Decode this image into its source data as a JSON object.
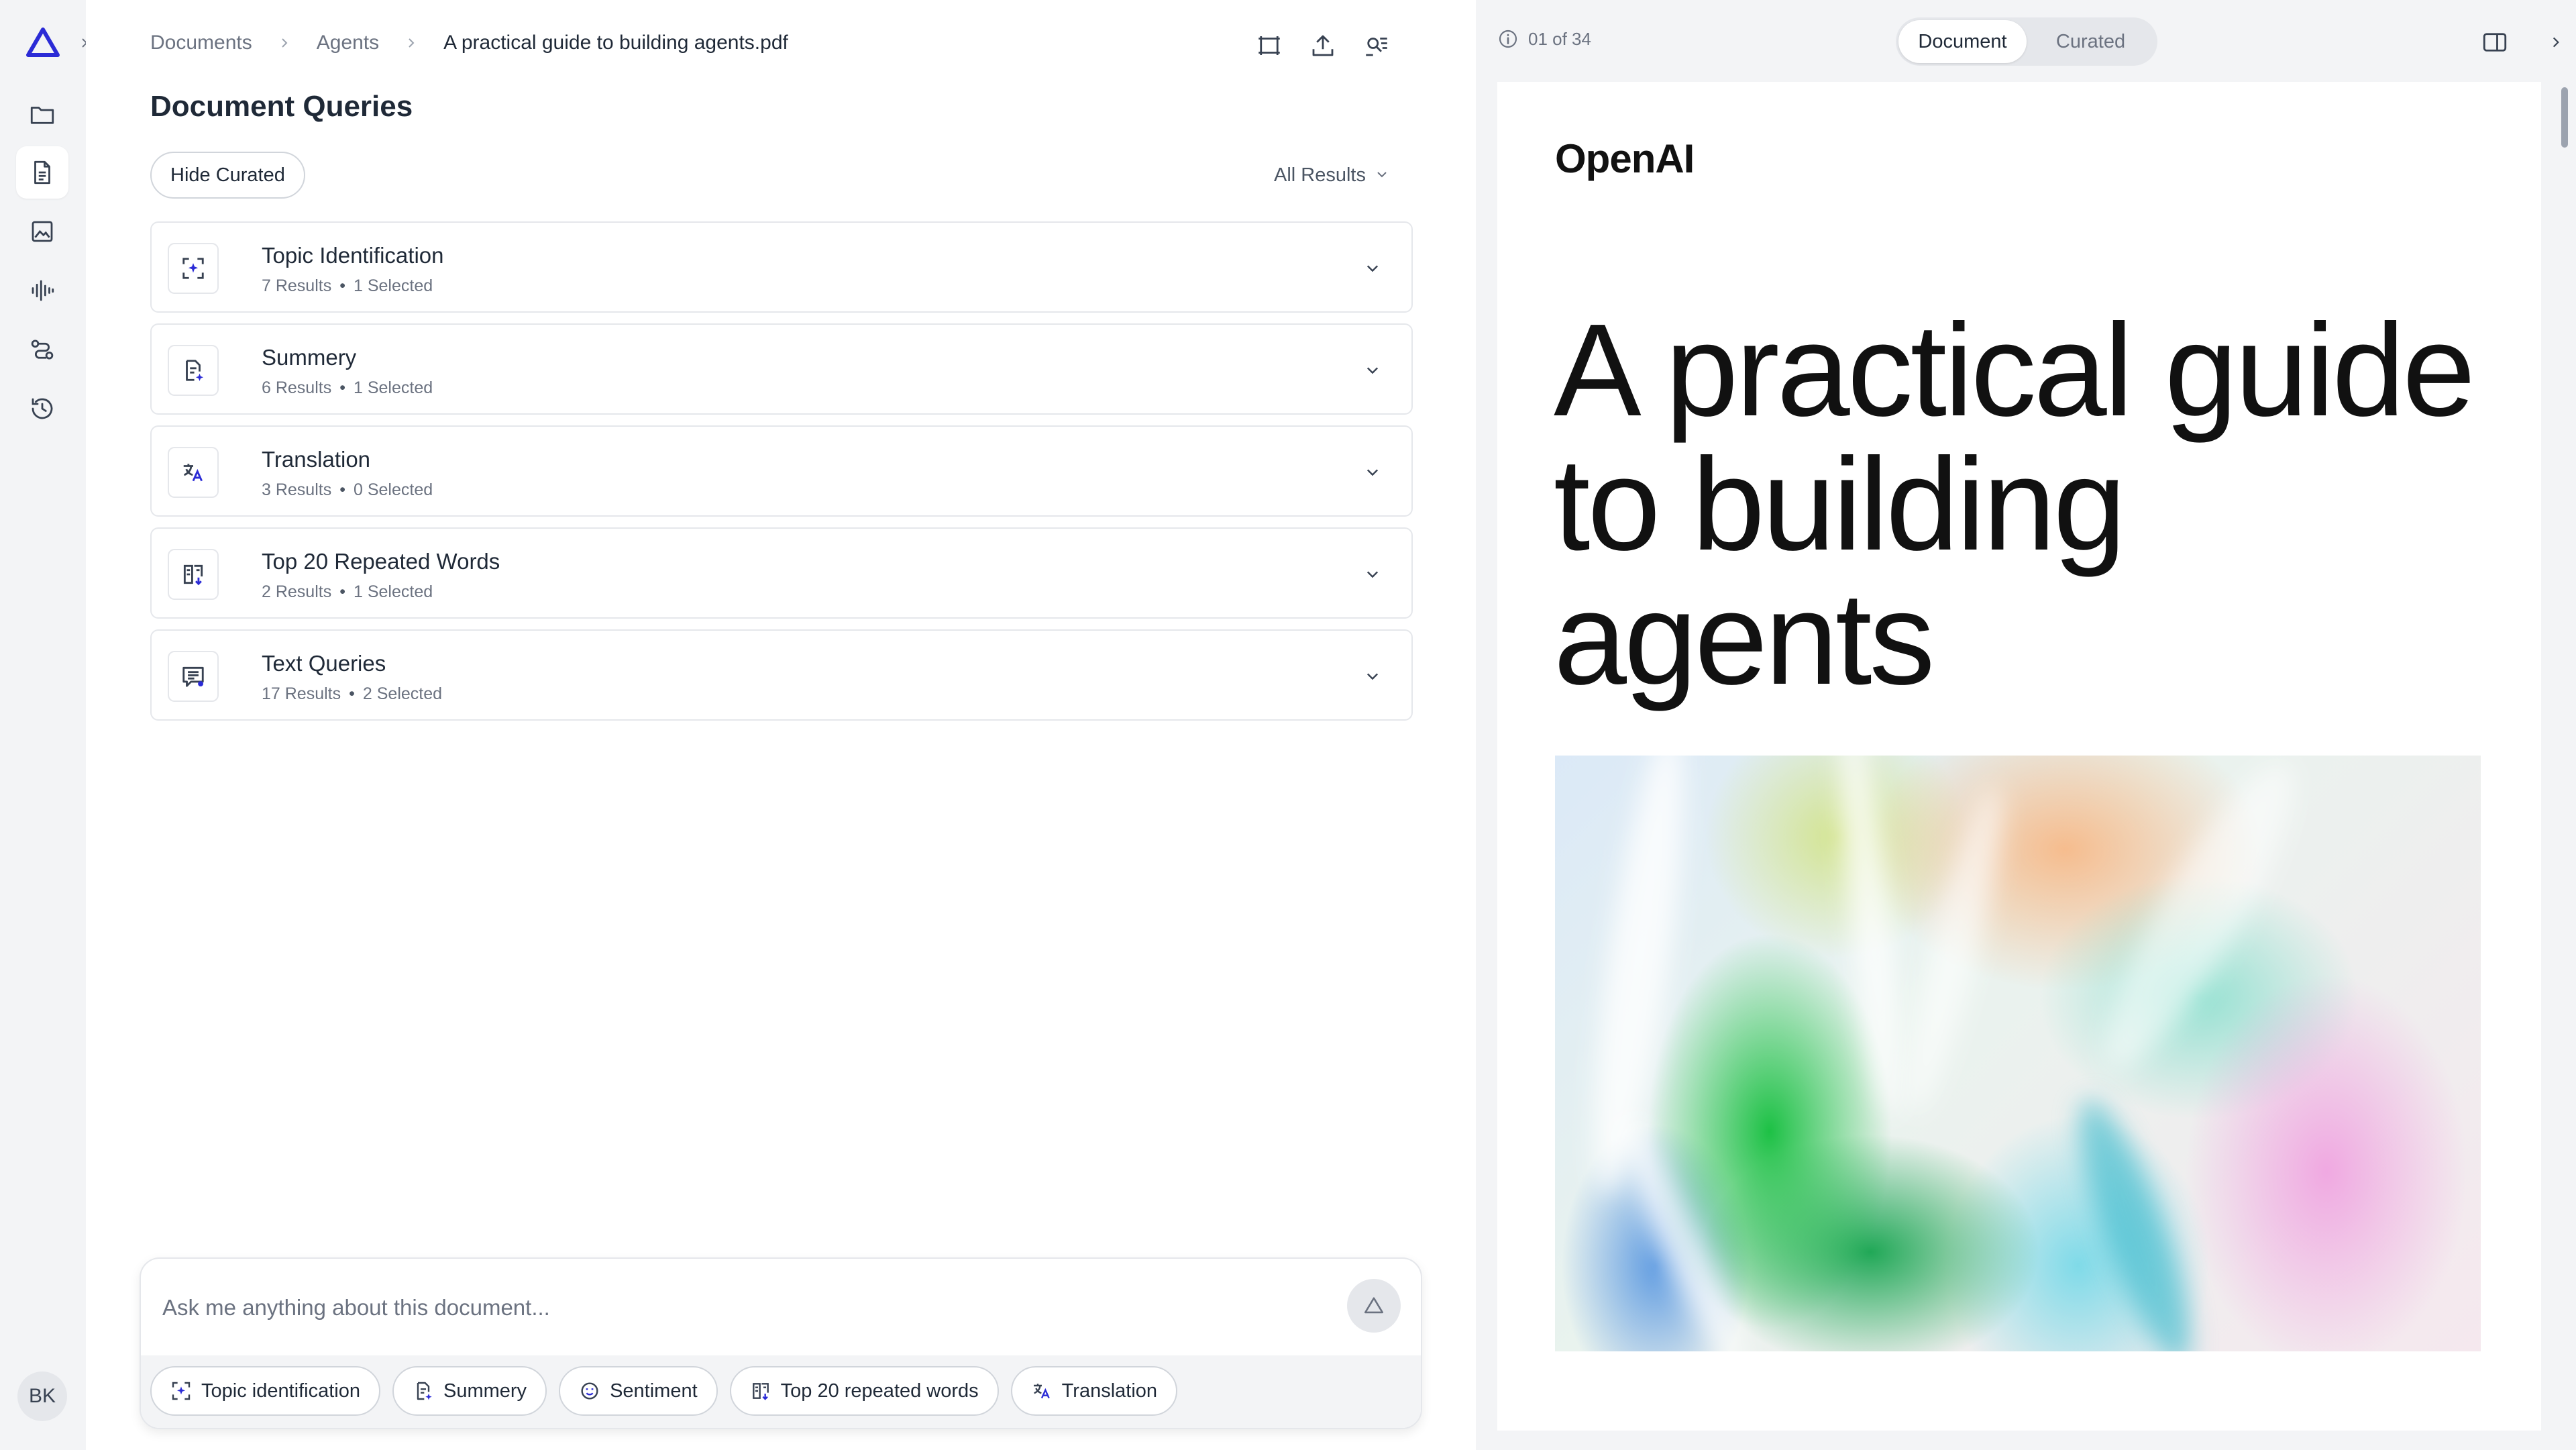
{
  "breadcrumb": {
    "items": [
      "Documents",
      "Agents"
    ],
    "current": "A practical guide to building agents.pdf"
  },
  "page_title": "Document Queries",
  "hide_curated_label": "Hide Curated",
  "filter": {
    "selected": "All Results"
  },
  "queries": [
    {
      "title": "Topic Identification",
      "results": "7 Results",
      "selected": "1 Selected",
      "icon": "topic-scan-icon"
    },
    {
      "title": "Summery",
      "results": "6 Results",
      "selected": "1 Selected",
      "icon": "summary-doc-icon"
    },
    {
      "title": "Translation",
      "results": "3 Results",
      "selected": "0 Selected",
      "icon": "translate-icon"
    },
    {
      "title": "Top 20 Repeated Words",
      "results": "2 Results",
      "selected": "1 Selected",
      "icon": "repeated-words-icon"
    },
    {
      "title": "Text Queries",
      "results": "17 Results",
      "selected": "2 Selected",
      "icon": "text-query-icon"
    }
  ],
  "composer": {
    "placeholder": "Ask me anything about this document...",
    "quick_actions": [
      "Topic identification",
      "Summery",
      "Sentiment",
      "Top 20 repeated words",
      "Translation"
    ]
  },
  "sidebar": {
    "icons": [
      "app-logo-icon",
      "folder-icon",
      "document-icon",
      "image-icon",
      "audio-wave-icon",
      "workflow-icon",
      "history-icon"
    ],
    "avatar_initials": "BK"
  },
  "viewer": {
    "page_indicator": "01 of 34",
    "tabs": [
      "Document",
      "Curated"
    ],
    "active_tab": "Document",
    "doc_logo": "OpenAI",
    "doc_heading": "A practical guide to building agents"
  },
  "colors": {
    "accent": "#2b2bd6",
    "rail_bg": "#f3f4f6",
    "card_border": "#e5e7eb"
  }
}
